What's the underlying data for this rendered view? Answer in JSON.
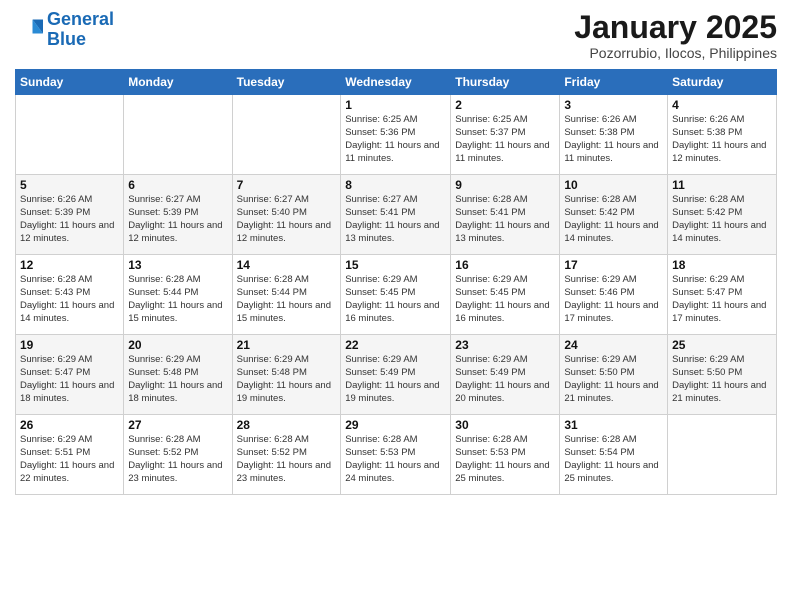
{
  "header": {
    "logo_line1": "General",
    "logo_line2": "Blue",
    "month_title": "January 2025",
    "subtitle": "Pozorrubio, Ilocos, Philippines"
  },
  "weekdays": [
    "Sunday",
    "Monday",
    "Tuesday",
    "Wednesday",
    "Thursday",
    "Friday",
    "Saturday"
  ],
  "weeks": [
    [
      {
        "day": "",
        "info": ""
      },
      {
        "day": "",
        "info": ""
      },
      {
        "day": "",
        "info": ""
      },
      {
        "day": "1",
        "info": "Sunrise: 6:25 AM\nSunset: 5:36 PM\nDaylight: 11 hours and 11 minutes."
      },
      {
        "day": "2",
        "info": "Sunrise: 6:25 AM\nSunset: 5:37 PM\nDaylight: 11 hours and 11 minutes."
      },
      {
        "day": "3",
        "info": "Sunrise: 6:26 AM\nSunset: 5:38 PM\nDaylight: 11 hours and 11 minutes."
      },
      {
        "day": "4",
        "info": "Sunrise: 6:26 AM\nSunset: 5:38 PM\nDaylight: 11 hours and 12 minutes."
      }
    ],
    [
      {
        "day": "5",
        "info": "Sunrise: 6:26 AM\nSunset: 5:39 PM\nDaylight: 11 hours and 12 minutes."
      },
      {
        "day": "6",
        "info": "Sunrise: 6:27 AM\nSunset: 5:39 PM\nDaylight: 11 hours and 12 minutes."
      },
      {
        "day": "7",
        "info": "Sunrise: 6:27 AM\nSunset: 5:40 PM\nDaylight: 11 hours and 12 minutes."
      },
      {
        "day": "8",
        "info": "Sunrise: 6:27 AM\nSunset: 5:41 PM\nDaylight: 11 hours and 13 minutes."
      },
      {
        "day": "9",
        "info": "Sunrise: 6:28 AM\nSunset: 5:41 PM\nDaylight: 11 hours and 13 minutes."
      },
      {
        "day": "10",
        "info": "Sunrise: 6:28 AM\nSunset: 5:42 PM\nDaylight: 11 hours and 14 minutes."
      },
      {
        "day": "11",
        "info": "Sunrise: 6:28 AM\nSunset: 5:42 PM\nDaylight: 11 hours and 14 minutes."
      }
    ],
    [
      {
        "day": "12",
        "info": "Sunrise: 6:28 AM\nSunset: 5:43 PM\nDaylight: 11 hours and 14 minutes."
      },
      {
        "day": "13",
        "info": "Sunrise: 6:28 AM\nSunset: 5:44 PM\nDaylight: 11 hours and 15 minutes."
      },
      {
        "day": "14",
        "info": "Sunrise: 6:28 AM\nSunset: 5:44 PM\nDaylight: 11 hours and 15 minutes."
      },
      {
        "day": "15",
        "info": "Sunrise: 6:29 AM\nSunset: 5:45 PM\nDaylight: 11 hours and 16 minutes."
      },
      {
        "day": "16",
        "info": "Sunrise: 6:29 AM\nSunset: 5:45 PM\nDaylight: 11 hours and 16 minutes."
      },
      {
        "day": "17",
        "info": "Sunrise: 6:29 AM\nSunset: 5:46 PM\nDaylight: 11 hours and 17 minutes."
      },
      {
        "day": "18",
        "info": "Sunrise: 6:29 AM\nSunset: 5:47 PM\nDaylight: 11 hours and 17 minutes."
      }
    ],
    [
      {
        "day": "19",
        "info": "Sunrise: 6:29 AM\nSunset: 5:47 PM\nDaylight: 11 hours and 18 minutes."
      },
      {
        "day": "20",
        "info": "Sunrise: 6:29 AM\nSunset: 5:48 PM\nDaylight: 11 hours and 18 minutes."
      },
      {
        "day": "21",
        "info": "Sunrise: 6:29 AM\nSunset: 5:48 PM\nDaylight: 11 hours and 19 minutes."
      },
      {
        "day": "22",
        "info": "Sunrise: 6:29 AM\nSunset: 5:49 PM\nDaylight: 11 hours and 19 minutes."
      },
      {
        "day": "23",
        "info": "Sunrise: 6:29 AM\nSunset: 5:49 PM\nDaylight: 11 hours and 20 minutes."
      },
      {
        "day": "24",
        "info": "Sunrise: 6:29 AM\nSunset: 5:50 PM\nDaylight: 11 hours and 21 minutes."
      },
      {
        "day": "25",
        "info": "Sunrise: 6:29 AM\nSunset: 5:50 PM\nDaylight: 11 hours and 21 minutes."
      }
    ],
    [
      {
        "day": "26",
        "info": "Sunrise: 6:29 AM\nSunset: 5:51 PM\nDaylight: 11 hours and 22 minutes."
      },
      {
        "day": "27",
        "info": "Sunrise: 6:28 AM\nSunset: 5:52 PM\nDaylight: 11 hours and 23 minutes."
      },
      {
        "day": "28",
        "info": "Sunrise: 6:28 AM\nSunset: 5:52 PM\nDaylight: 11 hours and 23 minutes."
      },
      {
        "day": "29",
        "info": "Sunrise: 6:28 AM\nSunset: 5:53 PM\nDaylight: 11 hours and 24 minutes."
      },
      {
        "day": "30",
        "info": "Sunrise: 6:28 AM\nSunset: 5:53 PM\nDaylight: 11 hours and 25 minutes."
      },
      {
        "day": "31",
        "info": "Sunrise: 6:28 AM\nSunset: 5:54 PM\nDaylight: 11 hours and 25 minutes."
      },
      {
        "day": "",
        "info": ""
      }
    ]
  ]
}
